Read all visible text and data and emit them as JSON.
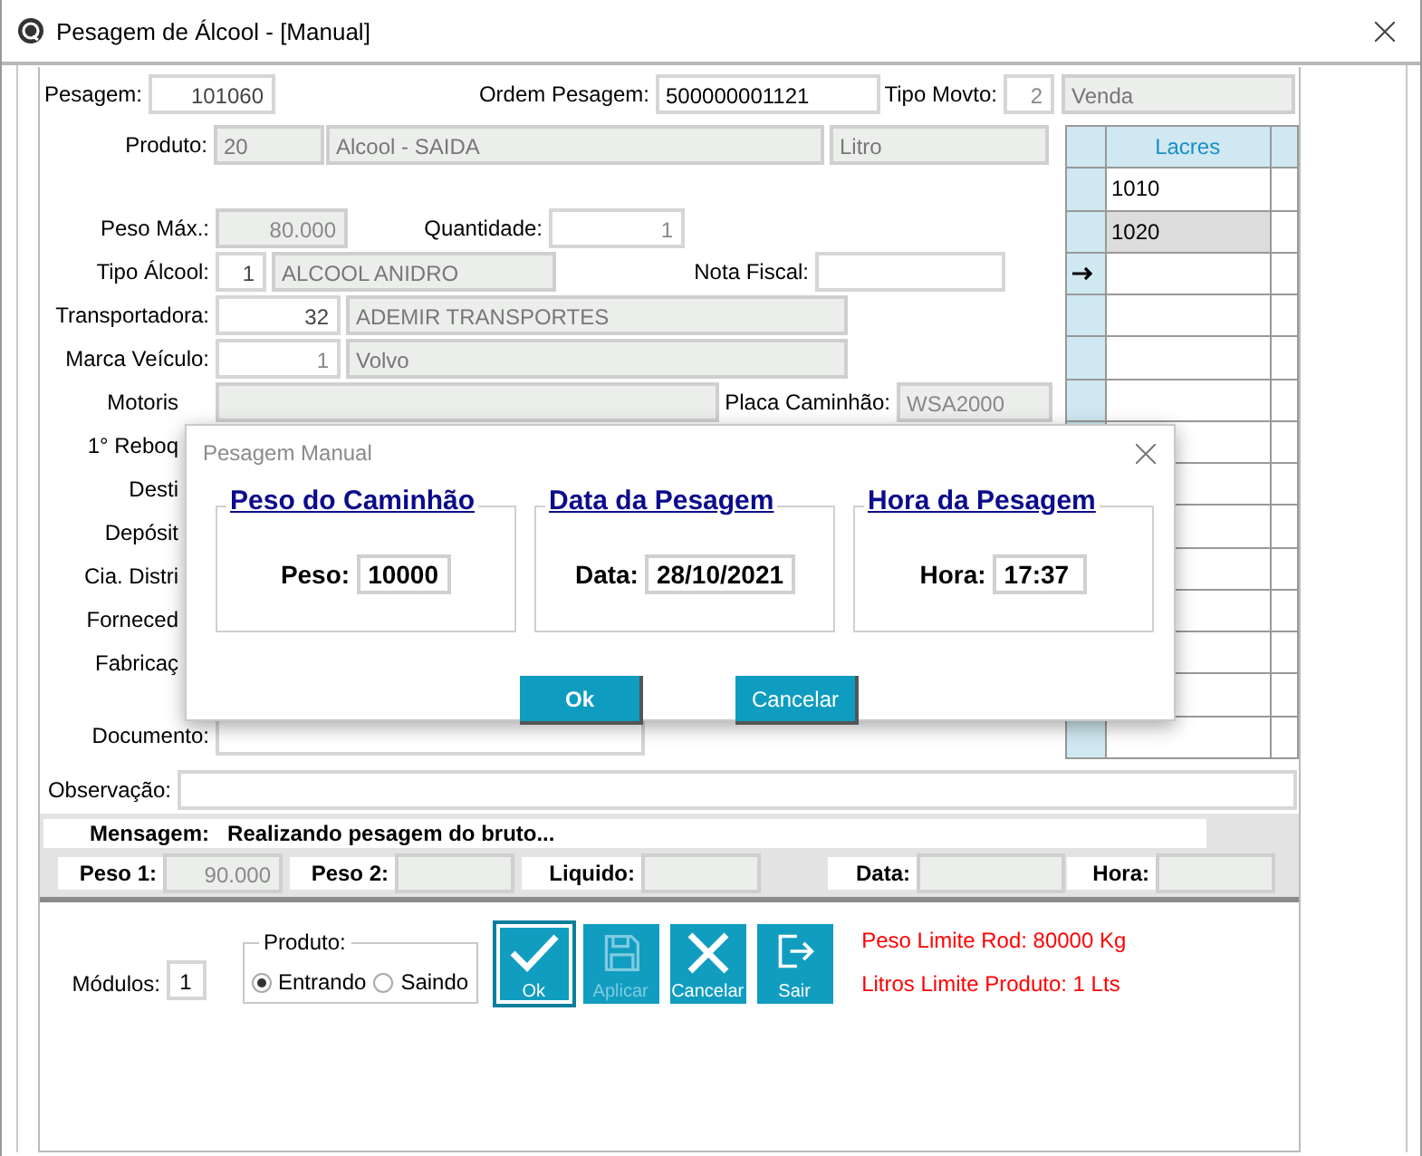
{
  "window": {
    "title": "Pesagem de Álcool - [Manual]"
  },
  "form": {
    "pesagem": {
      "label": "Pesagem:",
      "value": "101060"
    },
    "ordem_pesagem": {
      "label": "Ordem Pesagem:",
      "value": "500000001121"
    },
    "tipo_movto": {
      "label": "Tipo Movto:",
      "code": "2",
      "description": "Venda"
    },
    "produto": {
      "label": "Produto:",
      "code": "20",
      "description": "Alcool - SAIDA",
      "unit": "Litro"
    },
    "peso_max": {
      "label": "Peso Máx.:",
      "value": "80.000"
    },
    "quantidade": {
      "label": "Quantidade:",
      "value": "1"
    },
    "tipo_alcool": {
      "label": "Tipo Álcool:",
      "code": "1",
      "description": "ALCOOL ANIDRO"
    },
    "nota_fiscal": {
      "label": "Nota Fiscal:"
    },
    "transportadora": {
      "label": "Transportadora:",
      "code": "32",
      "description": "ADEMIR TRANSPORTES"
    },
    "marca_veiculo": {
      "label": "Marca Veículo:",
      "code": "1",
      "description": "Volvo"
    },
    "motorista": {
      "label": "Motoris"
    },
    "placa_caminhao": {
      "label": "Placa Caminhão:",
      "value": "WSA2000"
    },
    "covered_labels": [
      "1° Reboq",
      "Desti",
      "Depósit",
      "Cia. Distri",
      "Forneced",
      "Fabricaç"
    ],
    "documento": {
      "label": "Documento:"
    },
    "observacao": {
      "label": "Observação:"
    }
  },
  "lacres": {
    "column": "Lacres",
    "rows": [
      {
        "value": "1010",
        "selected": false
      },
      {
        "value": "1020",
        "selected": true
      }
    ]
  },
  "status": {
    "mensagem": {
      "label": "Mensagem:",
      "text": "Realizando pesagem do bruto..."
    },
    "weights": [
      {
        "label": "Peso 1:",
        "value": "90.000"
      },
      {
        "label": "Peso 2:"
      },
      {
        "label": "Liquido:"
      },
      {
        "label": "Data:"
      },
      {
        "label": "Hora:"
      }
    ]
  },
  "modulos": {
    "label": "Módulos:",
    "value": "1"
  },
  "produto_group": {
    "title": "Produto:",
    "options": [
      {
        "label": "Entrando",
        "selected": true
      },
      {
        "label": "Saindo",
        "selected": false
      }
    ]
  },
  "actions": [
    {
      "label": "Ok",
      "kind": "check",
      "disabled": false,
      "focused": true
    },
    {
      "label": "Aplicar",
      "kind": "save",
      "disabled": true,
      "focused": false
    },
    {
      "label": "Cancelar",
      "kind": "cancel",
      "disabled": false,
      "focused": false
    },
    {
      "label": "Sair",
      "kind": "exit",
      "disabled": false,
      "focused": false
    }
  ],
  "limits": [
    "Peso Limite Rod: 80000 Kg",
    "Litros Limite Produto: 1 Lts"
  ],
  "dialog": {
    "title": "Pesagem Manual",
    "groups": [
      {
        "title": "Peso do Caminhão",
        "label": "Peso:",
        "value": "10000"
      },
      {
        "title": "Data da Pesagem",
        "label": "Data:",
        "value": "28/10/2021"
      },
      {
        "title": "Hora da Pesagem",
        "label": "Hora:",
        "value": "17:37"
      }
    ],
    "buttons": [
      "Ok",
      "Cancelar"
    ]
  }
}
